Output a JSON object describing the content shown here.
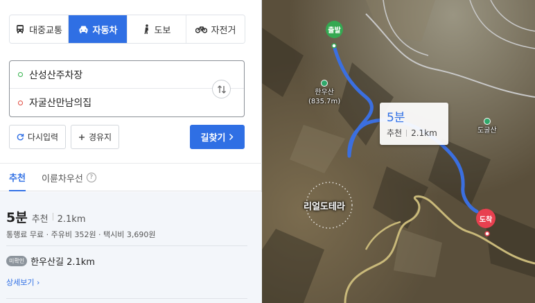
{
  "modes": [
    {
      "label": "대중교통",
      "icon": "bus-icon",
      "active": false
    },
    {
      "label": "자동차",
      "icon": "car-icon",
      "active": true
    },
    {
      "label": "도보",
      "icon": "walk-icon",
      "active": false
    },
    {
      "label": "자전거",
      "icon": "bicycle-icon",
      "active": false
    }
  ],
  "route": {
    "origin": "산성산주차장",
    "destination": "자굴산만남의집"
  },
  "buttons": {
    "reset": "다시입력",
    "waypoint": "경유지",
    "find": "길찾기"
  },
  "tabs": {
    "recommended": "추천",
    "fuel_priority": "이륜차우선"
  },
  "result": {
    "time": "5분",
    "tag": "추천",
    "distance": "2.1km",
    "cost": "통행료 무료 · 주유비 352원 · 택시비 3,690원",
    "badge": "미확인",
    "road": "한우산길 2.1km",
    "detail": "상세보기"
  },
  "map": {
    "start_label": "출발",
    "end_label": "도착",
    "peak1_name": "한우산",
    "peak1_height": "(835.7m)",
    "peak2_name": "도굴산",
    "area_name": "리얼도테라",
    "tooltip_time": "5분",
    "tooltip_tag": "추천",
    "tooltip_distance": "2.1km"
  },
  "colors": {
    "accent": "#2f6fe4",
    "start": "#35a852",
    "end": "#e8404f",
    "route": "#3b6fe0"
  }
}
